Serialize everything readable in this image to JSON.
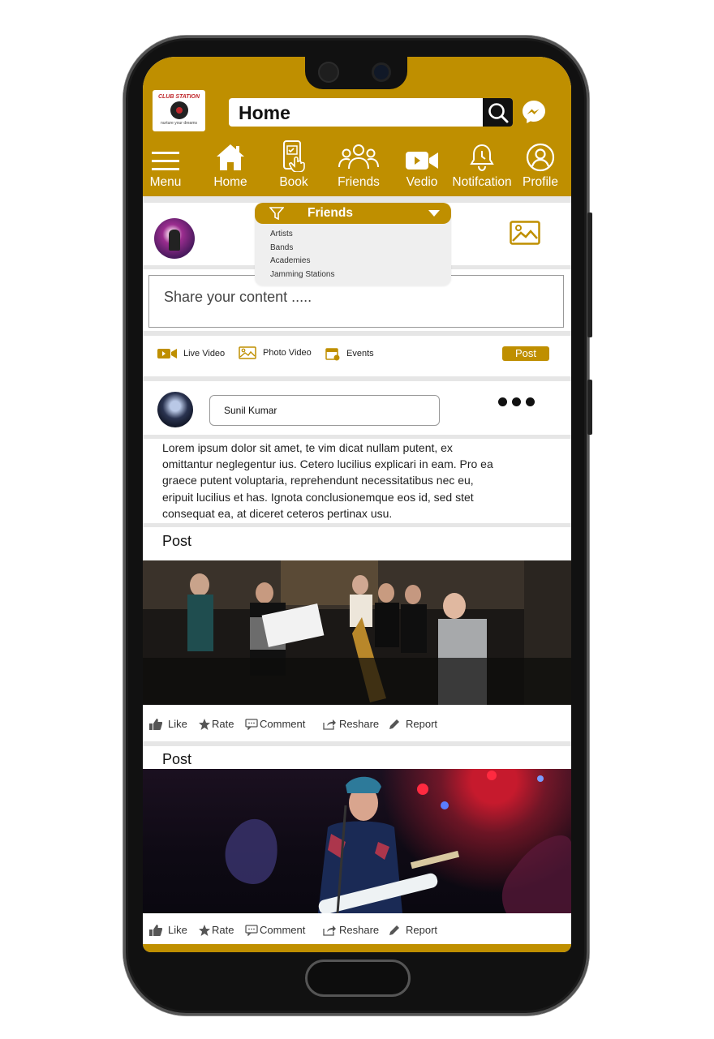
{
  "header": {
    "logo": {
      "title": "CLUB STATION",
      "tagline": "nurture your dreams"
    },
    "search_value": "Home",
    "colors": {
      "brand": "#bf8f00",
      "text_on_brand": "#ffffff"
    }
  },
  "nav": {
    "items": [
      {
        "label": "Menu",
        "icon": "hamburger-icon"
      },
      {
        "label": "Home",
        "icon": "house-icon"
      },
      {
        "label": "Book",
        "icon": "booking-phone-icon"
      },
      {
        "label": "Friends",
        "icon": "friends-group-icon"
      },
      {
        "label": "Vedio",
        "icon": "video-camera-icon"
      },
      {
        "label": "Notifcation",
        "icon": "bell-icon"
      },
      {
        "label": "Profile",
        "icon": "profile-icon"
      }
    ]
  },
  "filter": {
    "label": "Friends",
    "options": [
      "Artists",
      "Bands",
      "Academies",
      "Jamming Stations"
    ]
  },
  "composer": {
    "placeholder": "Share your content .....",
    "actions": [
      {
        "label": "Live Video",
        "icon": "live-video-icon"
      },
      {
        "label": "Photo Video",
        "icon": "photo-icon"
      },
      {
        "label": "Events",
        "icon": "calendar-icon"
      }
    ],
    "post_label": "Post"
  },
  "feed": {
    "author": "Sunil Kumar",
    "body": "Lorem ipsum dolor sit amet, te vim dicat nullam putent, ex omittantur neglegentur ius. Cetero lucilius explicari in eam. Pro ea graece putent voluptaria, reprehendunt necessitatibus nec eu, eripuit lucilius et has. Ignota conclusionemque eos id, sed stet consequat ea, at diceret ceteros pertinax usu.",
    "posts": [
      {
        "label": "Post"
      },
      {
        "label": "Post"
      }
    ],
    "reactions": [
      "Like",
      "Rate",
      "Comment",
      "Reshare",
      "Report"
    ]
  }
}
